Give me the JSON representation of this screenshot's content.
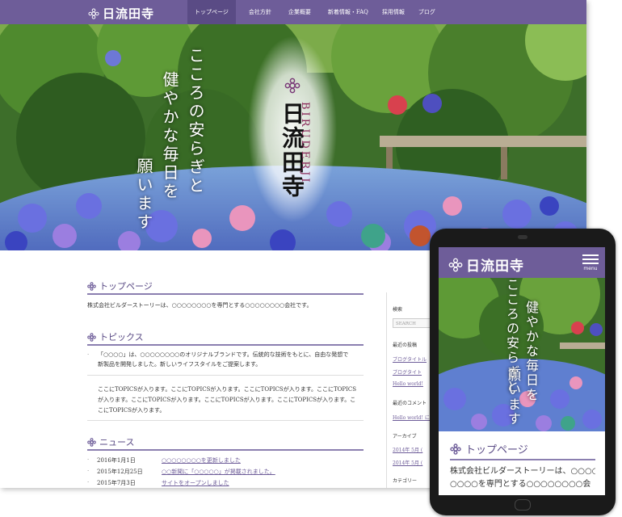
{
  "brand": {
    "name": "日流田寺",
    "roman": "BIRUDERJI"
  },
  "nav": {
    "items": [
      "トップページ",
      "会社方針",
      "企業概要",
      "新着情報・FAQ",
      "採用情報",
      "ブログ"
    ]
  },
  "hero": {
    "line1": "こころの安らぎと",
    "line2": "健やかな毎日を",
    "line3": "願います"
  },
  "top": {
    "heading": "トップページ",
    "text": "株式会社ビルダーストーリーは、○○○○○○○○を専門とする○○○○○○○○会社です。"
  },
  "topics": {
    "heading": "トピックス",
    "intro_line1": "「○○○○」は、○○○○○○○○のオリジナルブランドです。伝統的な技術をもとに、自由な発想で",
    "intro_line2": "新製品を開発しました。新しいライフスタイルをご提案します。",
    "body_line1": "ここにTOPICSが入ります。ここにTOPICSが入ります。ここにTOPICSが入ります。ここにTOPICS",
    "body_line2": "が入ります。ここにTOPICSが入ります。ここにTOPICSが入ります。ここにTOPICSが入ります。こ",
    "body_line3": "こにTOPICSが入ります。"
  },
  "news": {
    "heading": "ニュース",
    "items": [
      {
        "date": "2016年1月1日",
        "title": "○○○○○○○○を更新しました"
      },
      {
        "date": "2015年12月25日",
        "title": "○○新聞に「○○○○○」が掲載されました。"
      },
      {
        "date": "2015年7月3日",
        "title": "サイトをオープンしました"
      }
    ]
  },
  "sidebar": {
    "search_label": "検索",
    "search_placeholder": "SEARCH",
    "recent_posts_label": "最近の投稿",
    "recent_posts": [
      "ブログタイトル",
      "ブログタイト",
      "Hello world!"
    ],
    "recent_comments_label": "最近のコメント",
    "recent_comment": "Hello world! に W",
    "archive_label": "アーカイブ",
    "archives": [
      "2014年 5月 (",
      "2014年 5月 ("
    ],
    "category_label": "カテゴリー"
  },
  "phone": {
    "menu_label": "menu",
    "heading": "トップページ",
    "text_line1": "株式会社ビルダーストーリーは、○○○○",
    "text_line2": "○○○○を専門とする○○○○○○○○会"
  },
  "colors": {
    "brand": "#6e5d99",
    "brand_dark": "#5a4b85",
    "link": "#6e5d99"
  }
}
